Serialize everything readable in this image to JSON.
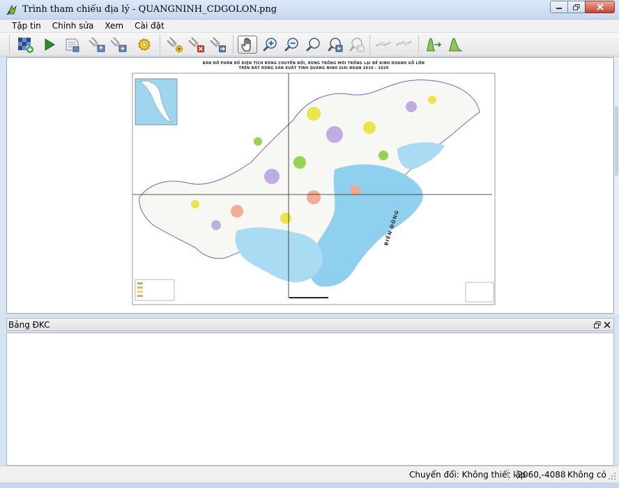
{
  "window": {
    "title": "Trình tham chiếu địa lý - QUANGNINH_CDGOLON.png"
  },
  "menu": [
    "Tập tin",
    "Chỉnh sửa",
    "Xem",
    "Cài đặt"
  ],
  "toolbar": {
    "icons": [
      "raster-add-icon",
      "play-icon",
      "georef-save-icon",
      "gcp-import-icon",
      "gcp-export-icon",
      "settings-gear-icon",
      "add-point-icon",
      "delete-point-icon",
      "move-point-icon",
      "pan-hand-icon",
      "zoom-in-icon",
      "zoom-out-icon",
      "zoom-layer-icon",
      "zoom-last-icon",
      "zoom-next-icon",
      "link-georef-to-qgis-icon",
      "link-qgis-to-georef-icon",
      "histogram-stretch-icon",
      "histogram-full-icon"
    ],
    "active": "pan-hand-icon"
  },
  "map": {
    "title_line1": "BẢN ĐỒ PHÂN BỐ DIỆN TÍCH RỪNG CHUYỂN ĐỔI, RỪNG TRỒNG MỚI TRỒNG LẠI ĐỂ KINH DOANH GỖ LỚN",
    "title_line2": "TRÊN ĐẤT RỪNG SẢN XUẤT TỈNH QUẢNG NINH GIAI ĐOẠN 2016 - 2020",
    "sea_label": "BIỂN ĐÔNG"
  },
  "gcp_panel": {
    "title": "Bảng ĐKC"
  },
  "status": {
    "transform": "Chuyển đổi: Không thiết lập",
    "coords": "-2060,-4088",
    "crs": "Không có"
  },
  "colors": {
    "sea": "#8fd0ee",
    "water": "#a9dbf3",
    "accent_active": "#7a7a7a",
    "close_button": "#c7432c"
  }
}
